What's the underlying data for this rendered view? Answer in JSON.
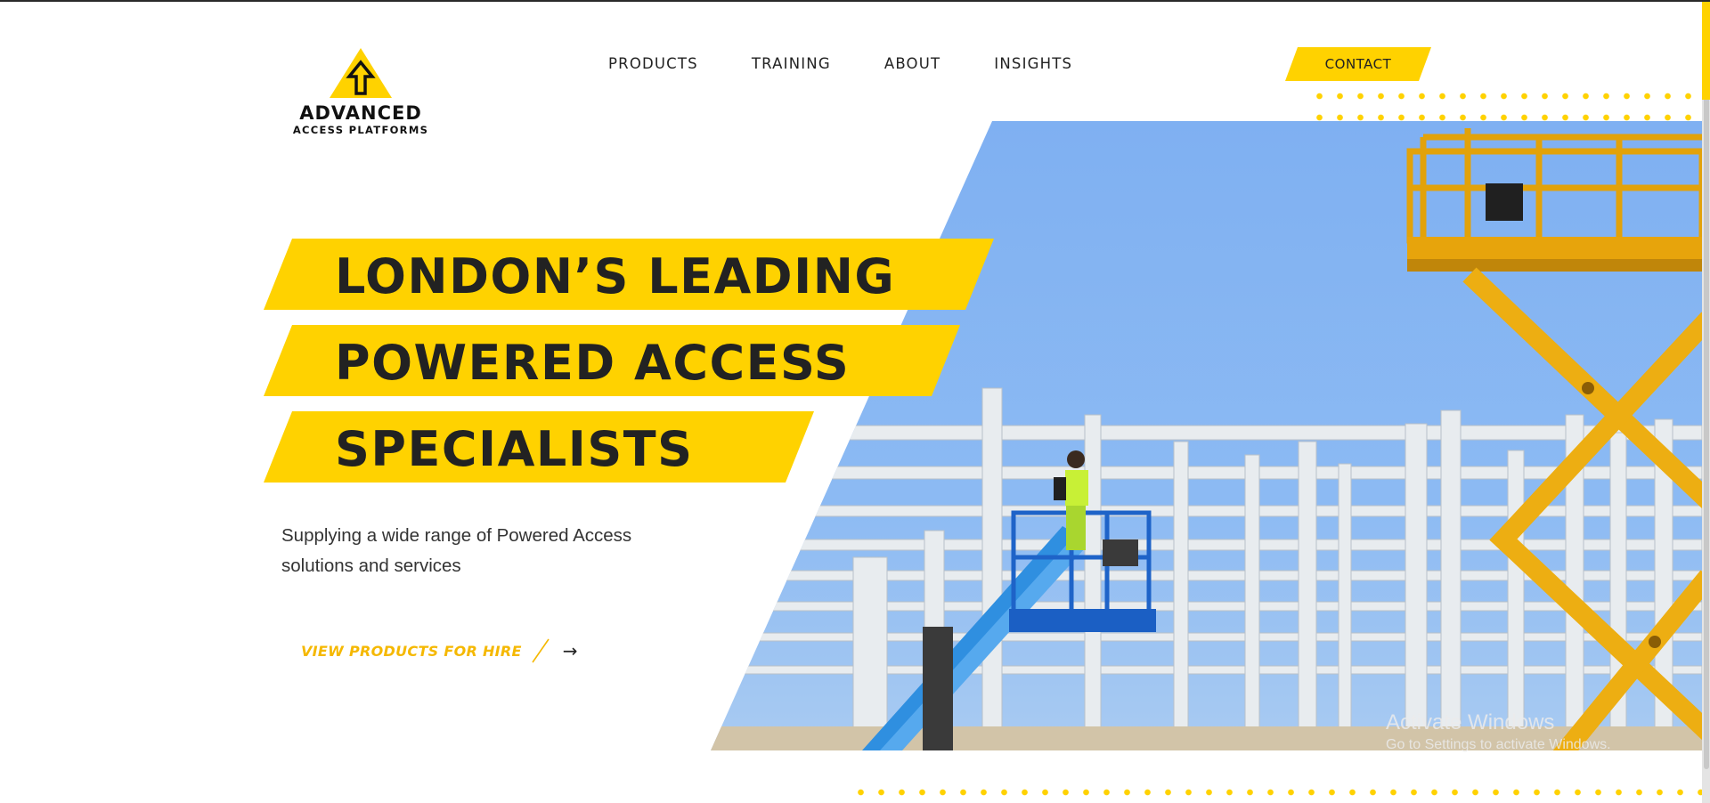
{
  "brand": {
    "logo_line1": "ADVANCED",
    "logo_line2": "ACCESS PLATFORMS",
    "accent_color": "#FFD200",
    "cta_color": "#F5B800"
  },
  "nav": {
    "items": [
      "PRODUCTS",
      "TRAINING",
      "ABOUT",
      "INSIGHTS"
    ],
    "contact_label": "CONTACT"
  },
  "hero": {
    "headline_lines": [
      "LONDON’S LEADING",
      "POWERED ACCESS",
      "SPECIALISTS"
    ],
    "subtitle": "Supplying a wide range of Powered Access solutions and services",
    "cta_label": "VIEW PRODUCTS FOR HIRE",
    "cta_arrow_icon": "arrow-right-icon",
    "image_subject": "workers on blue boom lift and yellow scissor lift beside steel frame construction"
  },
  "watermark": {
    "line1": "Activate Windows",
    "line2": "Go to Settings to activate Windows."
  }
}
